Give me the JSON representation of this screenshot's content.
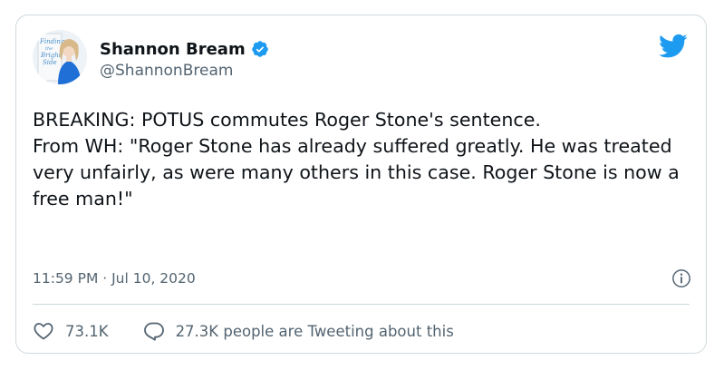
{
  "user": {
    "name": "Shannon Bream",
    "handle": "@ShannonBream",
    "avatar_book_text": [
      "Finding",
      "the",
      "Bright",
      "Side"
    ]
  },
  "tweet": {
    "text": "BREAKING:  POTUS commutes Roger Stone's sentence.\n From WH:  \"Roger Stone has already suffered greatly.  He was treated very unfairly, as were many others in this case.  Roger Stone is now a free man!\"",
    "timestamp": "11:59 PM · Jul 10, 2020"
  },
  "actions": {
    "likes": "73.1K",
    "discussion": "27.3K people are Tweeting about this"
  },
  "icons": {
    "brand": "twitter-bird-icon",
    "verified": "verified-badge-icon",
    "info": "info-icon",
    "like": "heart-icon",
    "reply": "comment-icon"
  },
  "colors": {
    "brand_blue": "#1d9bf0",
    "text_primary": "#0f1419",
    "text_secondary": "#536471",
    "border": "#cfd9de"
  }
}
